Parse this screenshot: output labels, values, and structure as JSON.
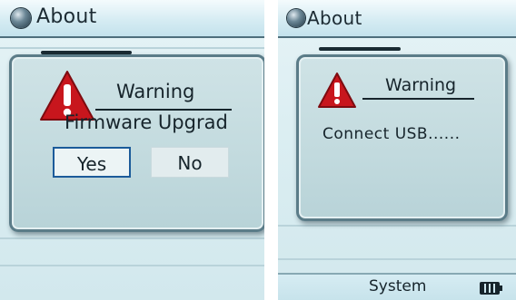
{
  "left_screen": {
    "header": {
      "title": "About",
      "icon": "globe-icon"
    },
    "dialog": {
      "icon": "warning-triangle-icon",
      "title": "Warning",
      "message": "Firmware Upgrad",
      "buttons": {
        "yes": "Yes",
        "no": "No"
      },
      "selected_button": "yes"
    }
  },
  "right_screen": {
    "header": {
      "title": "About",
      "icon": "globe-icon"
    },
    "dialog": {
      "icon": "warning-triangle-icon",
      "title": "Warning",
      "message": "Connect USB......"
    },
    "status_bar": {
      "label": "System",
      "icon": "battery-icon"
    }
  },
  "colors": {
    "accent_red": "#c8161d",
    "selection_border": "#1b5b9a",
    "screen_bg": "#dbeef2",
    "text": "#16242b"
  }
}
